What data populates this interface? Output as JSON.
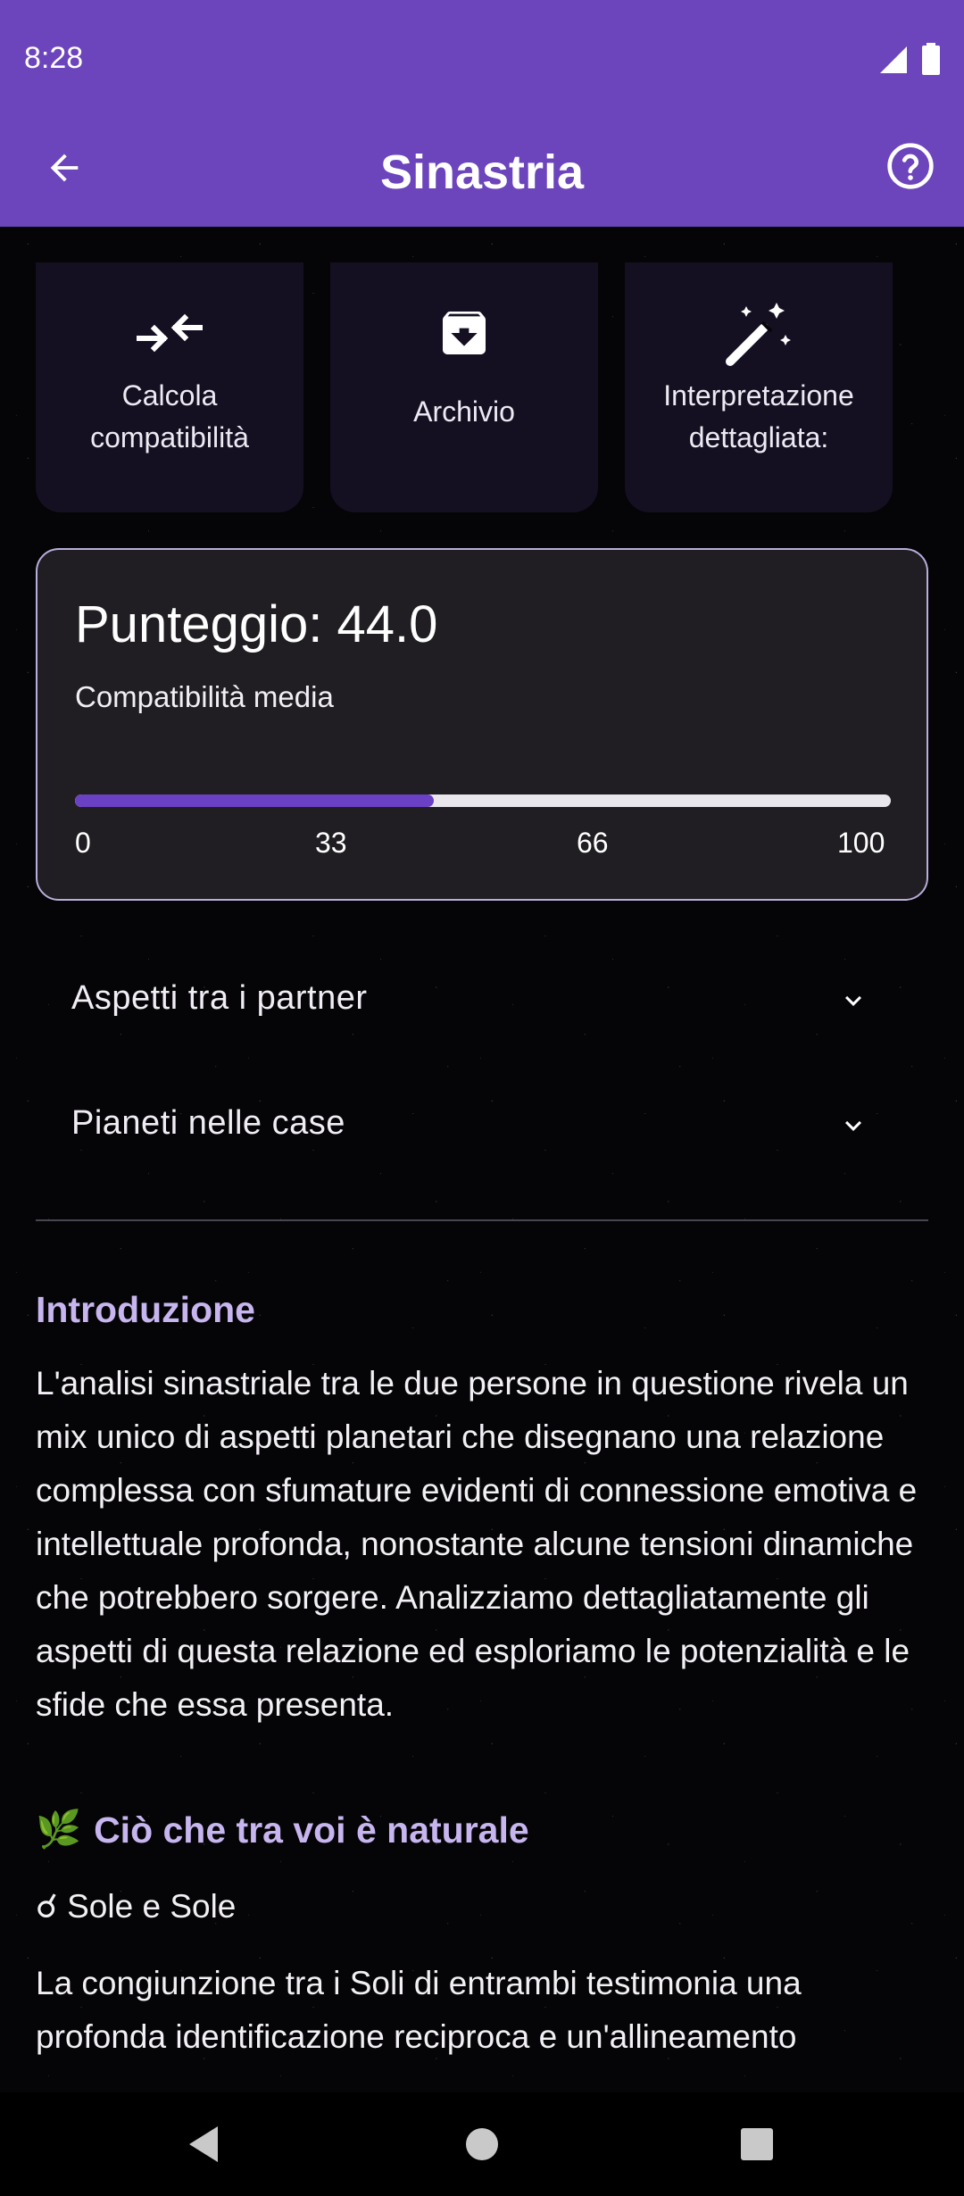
{
  "status_bar": {
    "time": "8:28"
  },
  "app_bar": {
    "title": "Sinastria"
  },
  "actions": [
    {
      "label": "Calcola\ncompatibilità",
      "icon": "compare-arrows-icon"
    },
    {
      "label": "Archivio",
      "icon": "archive-icon"
    },
    {
      "label": "Interpretazione\ndettagliata:",
      "icon": "magic-wand-icon"
    }
  ],
  "score": {
    "title": "Punteggio: 44.0",
    "value": 44.0,
    "max": 100,
    "subtitle": "Compatibilità media",
    "ticks": [
      "0",
      "33",
      "66",
      "100"
    ]
  },
  "expanders": [
    {
      "label": "Aspetti tra i partner"
    },
    {
      "label": "Pianeti nelle case"
    }
  ],
  "content": {
    "intro_heading": "Introduzione",
    "intro_text": "L'analisi sinastriale tra le due persone in questione rivela un mix unico di aspetti planetari che disegnano una relazione complessa con sfumature evidenti di connessione emotiva e intellettuale profonda, nonostante alcune tensioni dinamiche che potrebbero sorgere. Analizziamo dettagliatamente gli aspetti di questa relazione ed esploriamo le potenzialità e le sfide che essa presenta.",
    "natural_heading": "Ciò che tra voi è naturale",
    "natural_emoji": "🌿",
    "aspect_line": "☌ Sole e Sole",
    "aspect_text": "La congiunzione tra i Soli di entrambi testimonia una profonda identificazione reciproca e un'allineamento"
  },
  "colors": {
    "primary": "#6c44bc",
    "card_bg": "#151021",
    "score_bg": "#201e22",
    "heading": "#c6b5ee"
  }
}
